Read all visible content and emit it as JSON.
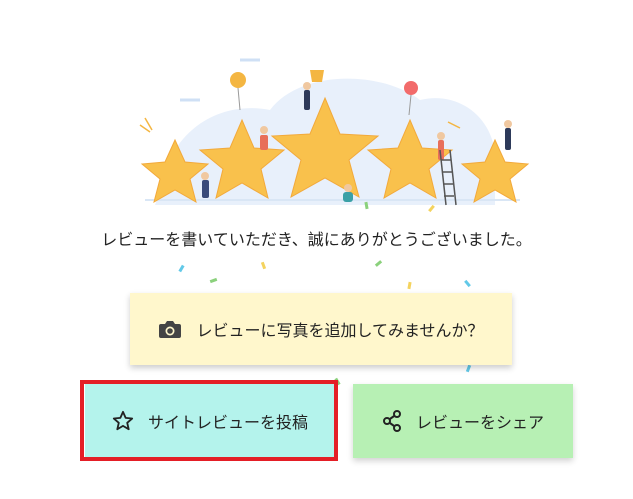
{
  "thanks_message": "レビューを書いていただき、誠にありがとうございました。",
  "photo_button": {
    "label": "レビューに写真を追加してみませんか？",
    "icon": "camera-icon"
  },
  "post_button": {
    "label": "サイトレビューを投稿",
    "icon": "star-icon"
  },
  "share_button": {
    "label": "レビューをシェア",
    "icon": "share-icon"
  },
  "colors": {
    "photo_bg": "#fff7cc",
    "post_bg": "#b4f3ec",
    "share_bg": "#b7f0b4",
    "highlight": "#e41e26",
    "star_fill": "#f9c14c"
  }
}
